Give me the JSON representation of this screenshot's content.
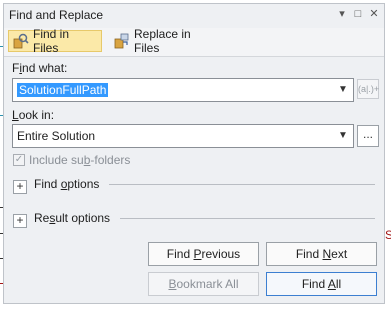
{
  "window": {
    "title": "Find and Replace",
    "buttons": {
      "dropdown": "▾",
      "maximize": "□",
      "close": "✕"
    }
  },
  "tabs": [
    {
      "label": "Find in Files",
      "active": true,
      "icon": "find-in-files-icon"
    },
    {
      "label": "Replace in Files",
      "active": false,
      "icon": "replace-in-files-icon"
    }
  ],
  "find_what": {
    "label_pre": "F",
    "label_accel": "i",
    "label_post": "nd what:",
    "value": "SolutionFullPath",
    "regex_hint": "(a|.)+"
  },
  "look_in": {
    "label_pre": "",
    "label_accel": "L",
    "label_post": "ook in:",
    "value": "Entire Solution",
    "browse_label": "..."
  },
  "include_subfolders": {
    "label_pre": "Include su",
    "label_accel": "b",
    "label_post": "-folders",
    "checked": true,
    "enabled": false
  },
  "find_options": {
    "label_pre": "Find ",
    "label_accel": "o",
    "label_post": "ptions",
    "expander": "+"
  },
  "result_options": {
    "label_pre": "Re",
    "label_accel": "s",
    "label_post": "ult options",
    "expander": "+"
  },
  "buttons": {
    "find_previous": {
      "pre": "Find ",
      "accel": "P",
      "post": "revious"
    },
    "find_next": {
      "pre": "Find ",
      "accel": "N",
      "post": "ext"
    },
    "bookmark_all": {
      "pre": "",
      "accel": "B",
      "post": "ookmark All"
    },
    "find_all": {
      "pre": "Find ",
      "accel": "A",
      "post": "ll"
    }
  },
  "background": {
    "edge_text": "S"
  },
  "colors": {
    "tab_active": "#fbe9a8",
    "selection": "#3399ff",
    "primary_border": "#3c7fd1"
  }
}
